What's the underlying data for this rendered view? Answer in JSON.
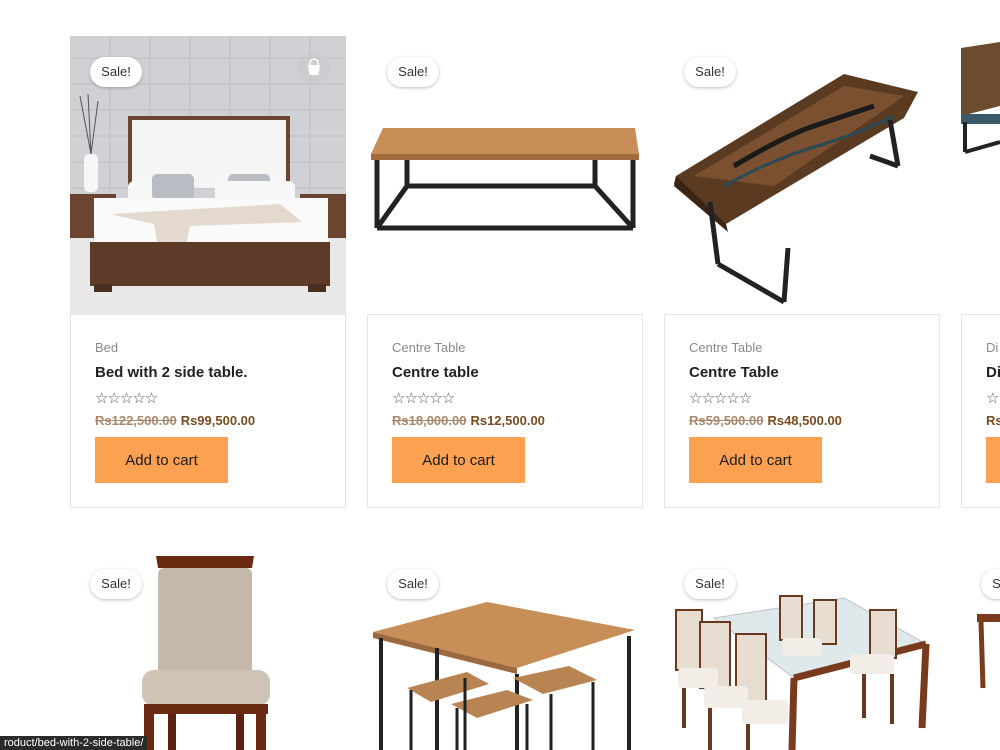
{
  "sale_badge": "Sale!",
  "add_to_cart_label": "Add to cart",
  "stars": "☆☆☆☆☆",
  "products": [
    {
      "category": "Bed",
      "title": "Bed with 2 side table.",
      "old_price": "Rs122,500.00",
      "new_price": "Rs99,500.00"
    },
    {
      "category": "Centre Table",
      "title": "Centre table",
      "old_price": "Rs18,000.00",
      "new_price": "Rs12,500.00"
    },
    {
      "category": "Centre Table",
      "title": "Centre Table",
      "old_price": "Rs59,500.00",
      "new_price": "Rs48,500.00"
    },
    {
      "category": "Di",
      "title": "Di",
      "old_price": "",
      "new_price": "Rs"
    }
  ],
  "status_url": "roduct/bed-with-2-side-table/",
  "colors": {
    "button": "#fca152",
    "old_price": "#a9876b",
    "new_price": "#7a4b1f"
  }
}
